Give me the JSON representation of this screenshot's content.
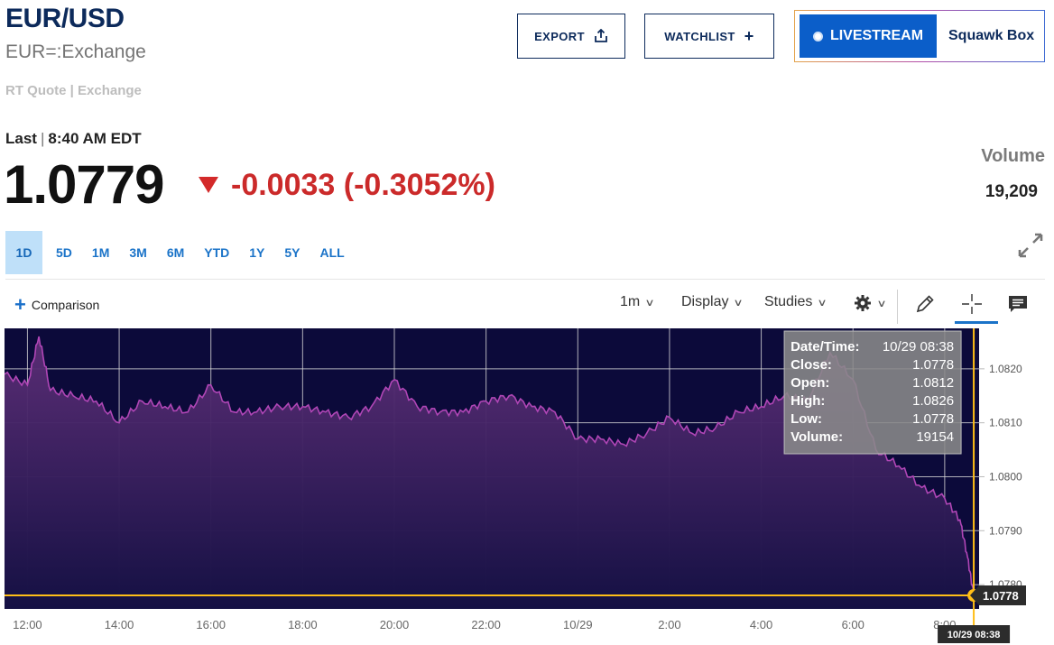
{
  "header": {
    "symbol": "EUR/USD",
    "exchange_line": "EUR=:Exchange",
    "rt_quote": "RT Quote | Exchange",
    "export_label": "EXPORT",
    "watchlist_label": "WATCHLIST",
    "livestream_label": "LIVESTREAM",
    "squawk_label": "Squawk Box"
  },
  "quote": {
    "last_label": "Last",
    "last_time": "8:40 AM EDT",
    "price": "1.0779",
    "change": "-0.0033 (-0.3052%)",
    "volume_label": "Volume",
    "volume_value": "19,209",
    "change_color": "#cb2a2a"
  },
  "ranges": [
    "1D",
    "5D",
    "1M",
    "3M",
    "6M",
    "YTD",
    "1Y",
    "5Y",
    "ALL"
  ],
  "active_range": "1D",
  "toolbar": {
    "comparison_label": "Comparison",
    "interval_label": "1m",
    "display_label": "Display",
    "studies_label": "Studies",
    "icons": [
      "settings-icon",
      "pencil-icon",
      "crosshair-icon",
      "comment-icon"
    ]
  },
  "tooltip": {
    "rows": [
      {
        "label": "Date/Time:",
        "value": "10/29 08:38"
      },
      {
        "label": "Close:",
        "value": "1.0778"
      },
      {
        "label": "Open:",
        "value": "1.0812"
      },
      {
        "label": "High:",
        "value": "1.0826"
      },
      {
        "label": "Low:",
        "value": "1.0778"
      },
      {
        "label": "Volume:",
        "value": "19154"
      }
    ]
  },
  "chart_data": {
    "type": "area",
    "series": [
      {
        "x": [
          "11:30",
          "12:00",
          "12:15",
          "12:30",
          "13:00",
          "13:30",
          "14:00",
          "14:30",
          "15:00",
          "15:30",
          "16:00",
          "16:30",
          "17:00",
          "17:30",
          "18:00",
          "18:30",
          "19:00",
          "19:30",
          "20:00",
          "20:30",
          "21:00",
          "21:30",
          "22:00",
          "22:30",
          "23:00",
          "23:30",
          "00:00",
          "00:30",
          "01:00",
          "01:30",
          "02:00",
          "02:30",
          "03:00",
          "03:30",
          "04:00",
          "04:30",
          "05:00",
          "05:30",
          "06:00",
          "06:30",
          "07:00",
          "07:30",
          "08:00",
          "08:20",
          "08:30",
          "08:38"
        ],
        "values": [
          1.0819,
          1.0817,
          1.0826,
          1.0816,
          1.0815,
          1.0814,
          1.081,
          1.0814,
          1.0813,
          1.0812,
          1.0817,
          1.0812,
          1.0812,
          1.0813,
          1.0813,
          1.0812,
          1.0811,
          1.0813,
          1.0818,
          1.0813,
          1.0812,
          1.0812,
          1.0814,
          1.0815,
          1.0813,
          1.0812,
          1.0807,
          1.0807,
          1.0806,
          1.0808,
          1.0811,
          1.0808,
          1.0809,
          1.0812,
          1.0813,
          1.0815,
          1.0814,
          1.0823,
          1.0818,
          1.0805,
          1.0802,
          1.0798,
          1.0796,
          1.0792,
          1.0785,
          1.0778
        ]
      }
    ],
    "x_ticks": [
      "12:00",
      "14:00",
      "16:00",
      "18:00",
      "20:00",
      "22:00",
      "10/29",
      "2:00",
      "4:00",
      "6:00",
      "8:00"
    ],
    "y_ticks": [
      "1.0780",
      "1.0790",
      "1.0800",
      "1.0810",
      "1.0820"
    ],
    "ylim": [
      1.07755,
      1.08275
    ],
    "crosshair": {
      "x": "08:38",
      "y": 1.0778,
      "y_label": "1.0778",
      "x_label": "10/29 08:38"
    },
    "colors": {
      "background": "#0c0a3a",
      "line": "#b046b6",
      "crosshair": "#ffbe17",
      "grid": "#d9d9d9"
    }
  }
}
